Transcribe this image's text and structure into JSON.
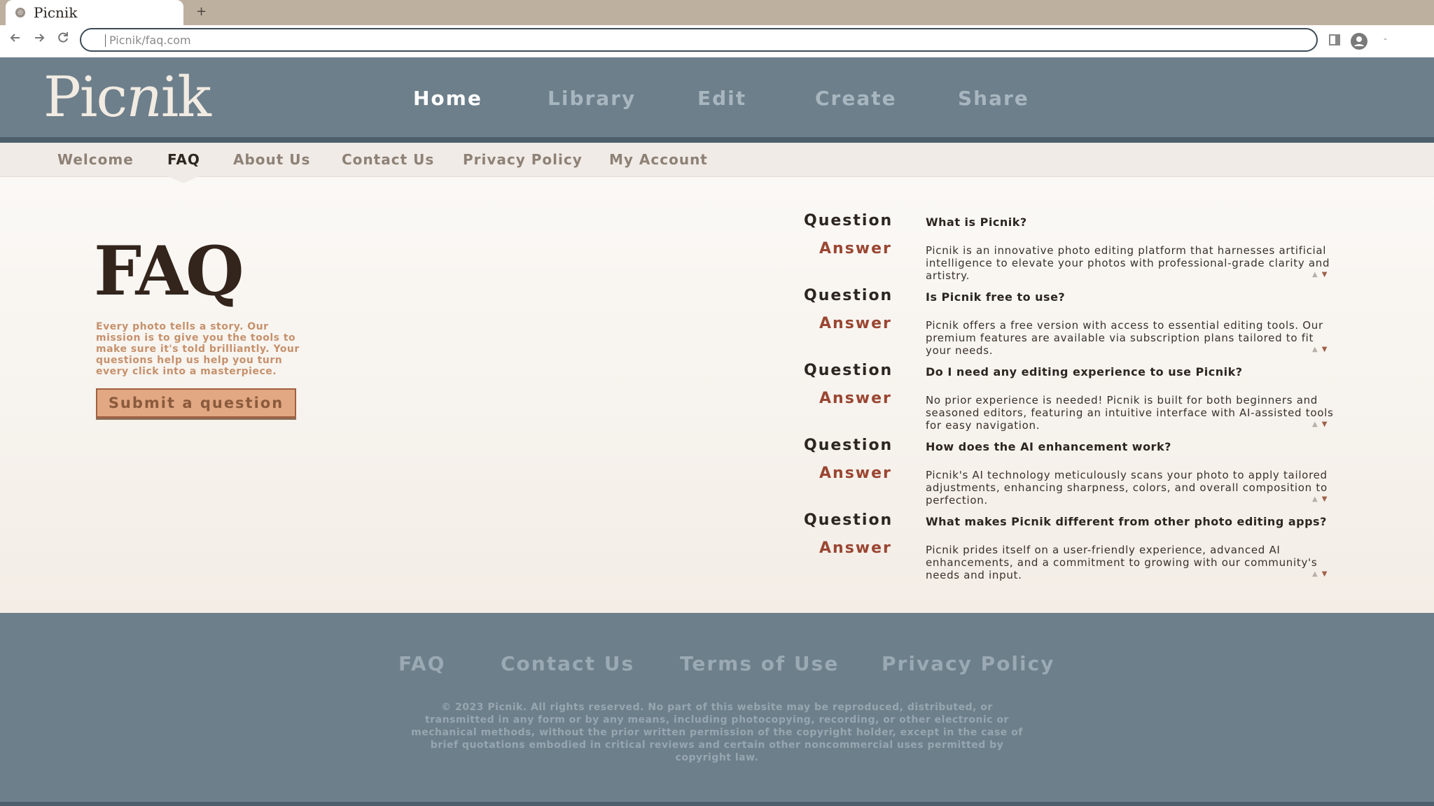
{
  "browser": {
    "tab_title": "Picnik",
    "new_tab": "+",
    "url": "Picnik/faq.com",
    "minimize": "-"
  },
  "header": {
    "logo_pic": "Pic",
    "logo_n": "n",
    "logo_ik": "ik",
    "nav": [
      "Home",
      "Library",
      "Edit",
      "Create",
      "Share"
    ],
    "active_nav": "Home"
  },
  "subnav": {
    "items": [
      "Welcome",
      "FAQ",
      "About Us",
      "Contact Us",
      "Privacy Policy",
      "My Account"
    ],
    "active": "FAQ"
  },
  "hero": {
    "title": "FAQ",
    "mission": "Every photo tells a story. Our mission is to give you the tools to make sure it's told brilliantly. Your questions help us help you turn every click into a masterpiece.",
    "submit_button": "Submit a question"
  },
  "faq": {
    "question_label": "Question",
    "answer_label": "Answer",
    "items": [
      {
        "question": "What is Picnik?",
        "answer": "Picnik is an innovative photo editing platform that harnesses artificial intelligence to elevate your photos with professional-grade clarity and artistry."
      },
      {
        "question": "Is Picnik free to use?",
        "answer": "Picnik offers a free version with access to essential editing tools. Our premium features are available via subscription plans tailored to fit your needs."
      },
      {
        "question": "Do I need any editing experience to use Picnik?",
        "answer": "No prior experience is needed! Picnik is built for both beginners and seasoned editors, featuring an intuitive interface with AI-assisted tools for easy navigation."
      },
      {
        "question": "How does the AI enhancement work?",
        "answer": "Picnik's AI technology meticulously scans your photo to apply tailored adjustments, enhancing sharpness, colors, and overall composition to perfection."
      },
      {
        "question": "What makes Picnik different from other photo editing apps?",
        "answer": "Picnik prides itself on a user-friendly experience, advanced AI enhancements, and a commitment to growing with our community's needs and input."
      }
    ],
    "arrow_up": "▲",
    "arrow_down": "▼"
  },
  "footer": {
    "links": [
      "FAQ",
      "Contact Us",
      "Terms of Use",
      "Privacy Policy"
    ],
    "copyright": "© 2023 Picnik. All rights reserved. No part of this website may be reproduced, distributed, or transmitted in any form or by any means, including photocopying, recording, or other electronic or mechanical methods, without the prior written permission of the copyright holder, except in the case of brief quotations embodied in critical reviews and certain other noncommercial uses permitted by copyright law."
  },
  "colors": {
    "header_bg": "#6d7f8b",
    "accent_answer": "#9a4632",
    "button_bg": "#e2a883",
    "mission_text": "#c6916c"
  }
}
